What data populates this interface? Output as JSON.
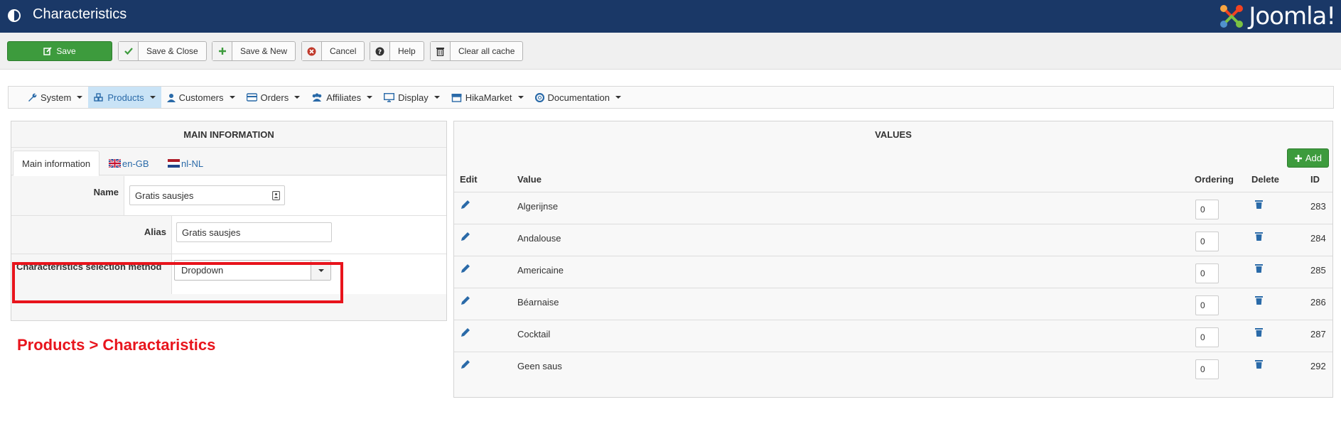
{
  "header": {
    "title": "Characteristics",
    "brand": "Joomla!"
  },
  "toolbar": {
    "save": "Save",
    "save_close": "Save & Close",
    "save_new": "Save & New",
    "cancel": "Cancel",
    "help": "Help",
    "clear_cache": "Clear all cache"
  },
  "nav": {
    "items": [
      {
        "label": "System",
        "icon": "wrench-icon"
      },
      {
        "label": "Products",
        "icon": "cubes-icon"
      },
      {
        "label": "Customers",
        "icon": "user-icon"
      },
      {
        "label": "Orders",
        "icon": "credit-card-icon"
      },
      {
        "label": "Affiliates",
        "icon": "users-icon"
      },
      {
        "label": "Display",
        "icon": "monitor-icon"
      },
      {
        "label": "HikaMarket",
        "icon": "store-icon"
      },
      {
        "label": "Documentation",
        "icon": "life-ring-icon"
      }
    ]
  },
  "main_info": {
    "heading": "MAIN INFORMATION",
    "tabs": [
      "Main information",
      "en-GB",
      "nl-NL"
    ],
    "name_label": "Name",
    "name_value": "Gratis sausjes",
    "alias_label": "Alias",
    "alias_value": "Gratis sausjes",
    "method_label": "Characteristics selection method",
    "method_value": "Dropdown"
  },
  "annotation": "Products > Charactaristics",
  "values": {
    "heading": "VALUES",
    "add_label": "Add",
    "columns": {
      "edit": "Edit",
      "value": "Value",
      "ordering": "Ordering",
      "delete": "Delete",
      "id": "ID"
    },
    "rows": [
      {
        "value": "Algerijnse",
        "ordering": "0",
        "id": "283"
      },
      {
        "value": "Andalouse",
        "ordering": "0",
        "id": "284"
      },
      {
        "value": "Americaine",
        "ordering": "0",
        "id": "285"
      },
      {
        "value": "Béarnaise",
        "ordering": "0",
        "id": "286"
      },
      {
        "value": "Cocktail",
        "ordering": "0",
        "id": "287"
      },
      {
        "value": "Geen saus",
        "ordering": "0",
        "id": "292"
      }
    ]
  },
  "colors": {
    "header_bg": "#1a3867",
    "save_green": "#3d9b3d",
    "link_blue": "#2a6aa8",
    "highlight_red": "#e8141c"
  }
}
